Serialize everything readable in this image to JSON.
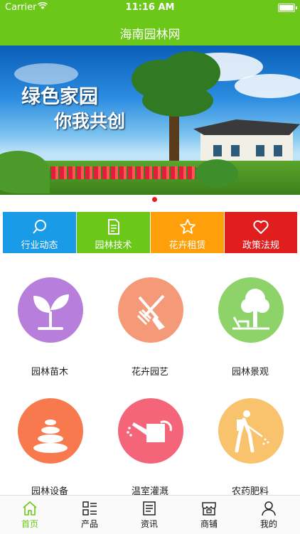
{
  "status": {
    "carrier": "Carrier",
    "time": "11:16 AM"
  },
  "nav": {
    "title": "海南园林网"
  },
  "banner": {
    "line1": "绿色家园",
    "line2": "你我共创",
    "page_index": 1,
    "page_count": 1
  },
  "categories": [
    {
      "label": "行业动态",
      "icon": "search-icon",
      "color": "#1a9be8"
    },
    {
      "label": "园林技术",
      "icon": "document-icon",
      "color": "#6cc818"
    },
    {
      "label": "花卉租赁",
      "icon": "star-icon",
      "color": "#ff9f0a"
    },
    {
      "label": "政策法规",
      "icon": "heart-icon",
      "color": "#e01e1e"
    }
  ],
  "grid": [
    {
      "label": "园林苗木",
      "icon": "seedling-icon",
      "color": "#b77fdb"
    },
    {
      "label": "花卉园艺",
      "icon": "shovel-fork-icon",
      "color": "#f49a78"
    },
    {
      "label": "园林景观",
      "icon": "tree-bench-icon",
      "color": "#8ed36a"
    },
    {
      "label": "园林设备",
      "icon": "stones-icon",
      "color": "#f8794d"
    },
    {
      "label": "温室灌溉",
      "icon": "watering-can-icon",
      "color": "#f4657a"
    },
    {
      "label": "农药肥料",
      "icon": "sprayer-icon",
      "color": "#f8c36c"
    }
  ],
  "tabs": [
    {
      "label": "首页",
      "icon": "home-icon",
      "active": true
    },
    {
      "label": "产品",
      "icon": "grid-list-icon",
      "active": false
    },
    {
      "label": "资讯",
      "icon": "news-icon",
      "active": false
    },
    {
      "label": "商铺",
      "icon": "store-icon",
      "active": false
    },
    {
      "label": "我的",
      "icon": "user-icon",
      "active": false
    }
  ],
  "colors": {
    "brand": "#6cc818"
  }
}
